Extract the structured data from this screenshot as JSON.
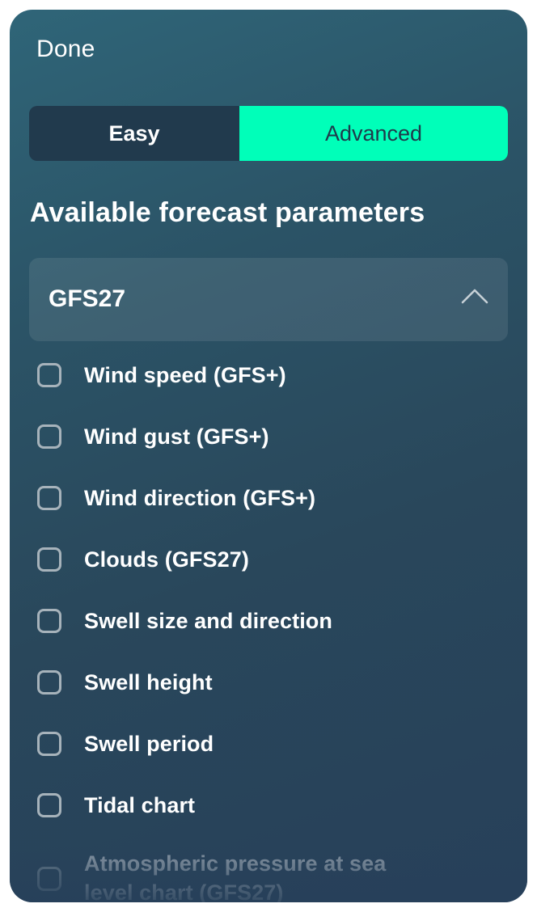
{
  "header": {
    "done_label": "Done"
  },
  "mode_toggle": {
    "easy_label": "Easy",
    "advanced_label": "Advanced",
    "selected": "Advanced"
  },
  "section": {
    "title": "Available forecast parameters"
  },
  "model_group": {
    "title": "GFS27",
    "expanded": true,
    "icon": "chevron-up-icon"
  },
  "parameters": [
    {
      "label": "Wind speed (GFS+)",
      "checked": false
    },
    {
      "label": "Wind gust (GFS+)",
      "checked": false
    },
    {
      "label": "Wind direction (GFS+)",
      "checked": false
    },
    {
      "label": "Clouds (GFS27)",
      "checked": false
    },
    {
      "label": "Swell size and direction",
      "checked": false
    },
    {
      "label": "Swell height",
      "checked": false
    },
    {
      "label": "Swell period",
      "checked": false
    },
    {
      "label": "Tidal chart",
      "checked": false
    },
    {
      "label": "Atmospheric pressure at sea level chart (GFS27)",
      "checked": false
    }
  ],
  "colors": {
    "accent": "#00ffb9",
    "panel_dark": "#213a4d",
    "text": "#ffffff"
  }
}
